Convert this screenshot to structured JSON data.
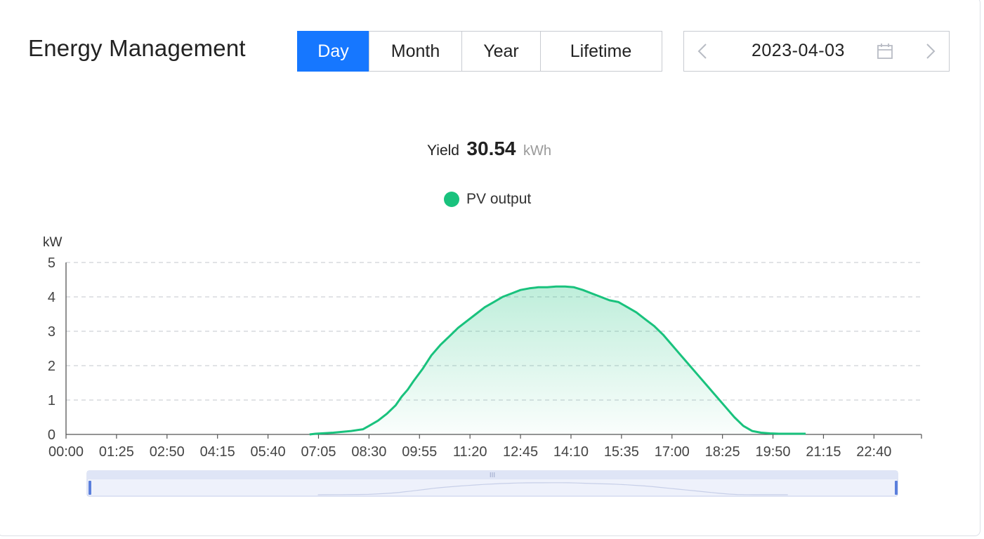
{
  "header": {
    "title": "Energy Management",
    "tabs": [
      {
        "label": "Day",
        "active": true
      },
      {
        "label": "Month",
        "active": false
      },
      {
        "label": "Year",
        "active": false
      },
      {
        "label": "Lifetime",
        "active": false
      }
    ],
    "date": "2023-04-03",
    "prev_icon": "chevron-left-icon",
    "next_icon": "chevron-right-icon",
    "calendar_icon": "calendar-icon"
  },
  "summary": {
    "label": "Yield",
    "value": "30.54",
    "unit": "kWh"
  },
  "legend": {
    "label": "PV output",
    "color": "#19c27d"
  },
  "colors": {
    "accent": "#1677ff",
    "series": "#19c27d"
  },
  "chart_data": {
    "type": "area",
    "ylabel": "kW",
    "ylim": [
      0,
      5
    ],
    "yticks": [
      "0",
      "1",
      "2",
      "3",
      "4",
      "5"
    ],
    "xlim": [
      "00:00",
      "24:00"
    ],
    "xticks": [
      "00:00",
      "01:25",
      "02:50",
      "04:15",
      "05:40",
      "07:05",
      "08:30",
      "09:55",
      "11:20",
      "12:45",
      "14:10",
      "15:35",
      "17:00",
      "18:25",
      "19:50",
      "21:15",
      "22:40"
    ],
    "grid": true,
    "legend_position": "top-center",
    "zoom_slider": {
      "start": 0.026,
      "end": 0.972
    },
    "series": [
      {
        "name": "PV output",
        "color": "#19c27d",
        "x": [
          "06:50",
          "07:00",
          "07:30",
          "08:00",
          "08:20",
          "08:30",
          "08:45",
          "09:00",
          "09:15",
          "09:25",
          "09:35",
          "09:45",
          "10:00",
          "10:15",
          "10:30",
          "10:45",
          "11:00",
          "11:15",
          "11:30",
          "11:45",
          "12:00",
          "12:15",
          "12:30",
          "12:45",
          "13:00",
          "13:15",
          "13:30",
          "13:45",
          "14:00",
          "14:15",
          "14:30",
          "14:45",
          "15:00",
          "15:15",
          "15:30",
          "15:45",
          "16:00",
          "16:15",
          "16:30",
          "16:45",
          "17:00",
          "17:15",
          "17:30",
          "17:45",
          "18:00",
          "18:15",
          "18:30",
          "18:45",
          "19:00",
          "19:15",
          "19:30",
          "19:45",
          "20:00",
          "20:30",
          "20:45"
        ],
        "y": [
          0.0,
          0.02,
          0.05,
          0.1,
          0.15,
          0.25,
          0.4,
          0.6,
          0.85,
          1.1,
          1.3,
          1.55,
          1.9,
          2.3,
          2.6,
          2.85,
          3.1,
          3.3,
          3.5,
          3.7,
          3.85,
          4.0,
          4.1,
          4.2,
          4.25,
          4.28,
          4.28,
          4.3,
          4.3,
          4.28,
          4.2,
          4.1,
          4.0,
          3.9,
          3.85,
          3.7,
          3.55,
          3.35,
          3.15,
          2.9,
          2.6,
          2.3,
          2.0,
          1.7,
          1.4,
          1.1,
          0.8,
          0.5,
          0.25,
          0.1,
          0.05,
          0.03,
          0.02,
          0.02,
          0.02
        ]
      }
    ]
  }
}
